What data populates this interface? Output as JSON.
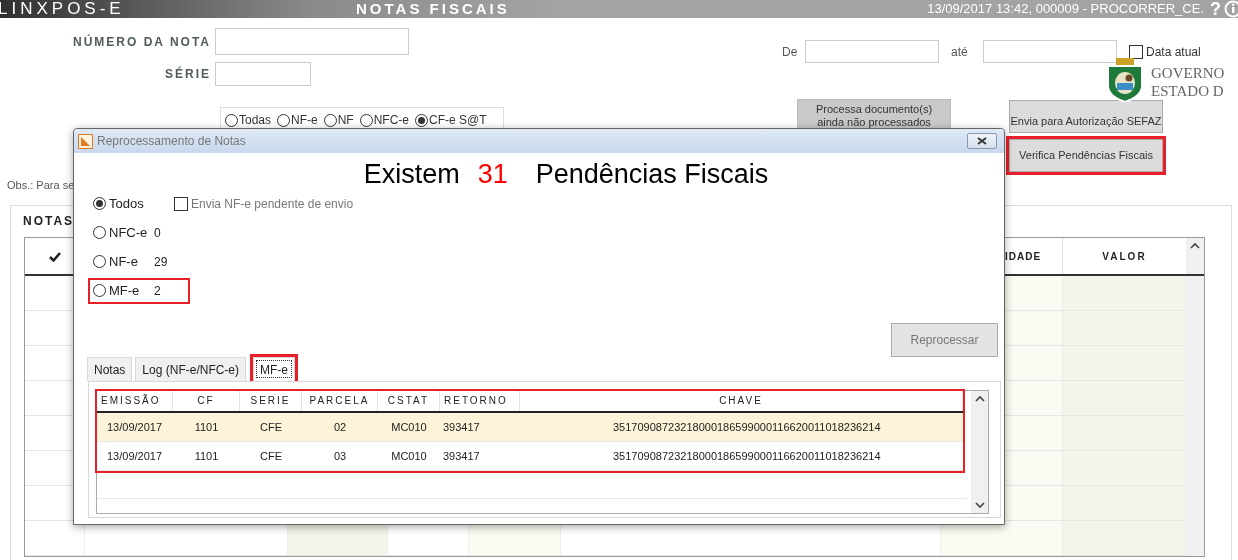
{
  "header": {
    "logo": "LINXPOS-E",
    "title": "NOTAS FISCAIS",
    "session": "13/09/2017 13:42, 000009 - PROCORRER_CE.",
    "help": "?"
  },
  "search": {
    "number_label": "NÚMERO DA NOTA",
    "series_label": "SÉRIE",
    "from_label": "De",
    "to_label": "até",
    "current_date": {
      "label": "Data atual",
      "checked": false
    },
    "types": [
      {
        "label": "Todas",
        "selected": false
      },
      {
        "label": "NF-e",
        "selected": false
      },
      {
        "label": "NF",
        "selected": false
      },
      {
        "label": "NFC-e",
        "selected": false
      },
      {
        "label": "CF-e S@T",
        "selected": true
      }
    ]
  },
  "government_logo": [
    "GOVERNO",
    "ESTADO D"
  ],
  "actions": [
    {
      "label": "Processa documento(s) ainda não processados",
      "highlighted": false
    },
    {
      "label": "Envia para Autorização SEFAZ",
      "highlighted": false
    },
    {
      "label": "Verifica Pendências Fiscais",
      "highlighted": true
    }
  ],
  "note": "Obs.: Para se",
  "notes_panel": {
    "title": "NOTAS",
    "columns": [
      "IDADE",
      "VALOR"
    ]
  },
  "dialog": {
    "title": "Reprocessamento de Notas",
    "heading_before": "Existem",
    "pending_count": "31",
    "heading_after": "Pendências Fiscais",
    "options": [
      {
        "label": "Todos",
        "selected": true,
        "highlighted": false
      },
      {
        "label": "NFC-e",
        "count": "0",
        "selected": false,
        "highlighted": false
      },
      {
        "label": "NF-e",
        "count": "29",
        "selected": false,
        "highlighted": false
      },
      {
        "label": "MF-e",
        "count": "2",
        "selected": false,
        "highlighted": true
      }
    ],
    "send_pending": {
      "label": "Envia NF-e pendente de envio",
      "checked": false
    },
    "reprocess_button": {
      "label": "Reprocessar",
      "disabled": true
    },
    "tabs": [
      {
        "label": "Notas",
        "selected": false,
        "highlighted": false
      },
      {
        "label": "Log (NF-e/NFC-e)",
        "selected": false,
        "highlighted": false
      },
      {
        "label": "MF-e",
        "selected": true,
        "highlighted": true
      }
    ],
    "grid": {
      "highlighted": true,
      "columns": [
        "EMISSÃO",
        "CF",
        "SERIE",
        "PARCELA",
        "CSTAT",
        "RETORNO",
        "CHAVE"
      ],
      "rows": [
        {
          "selected": true,
          "cells": [
            "13/09/2017",
            "1101",
            "CFE",
            "02",
            "MC010",
            "393417",
            "35170908723218000186599000116620011018236214"
          ]
        },
        {
          "selected": false,
          "cells": [
            "13/09/2017",
            "1101",
            "CFE",
            "03",
            "MC010",
            "393417",
            "35170908723218000186599000116620011018236214"
          ]
        }
      ]
    }
  }
}
